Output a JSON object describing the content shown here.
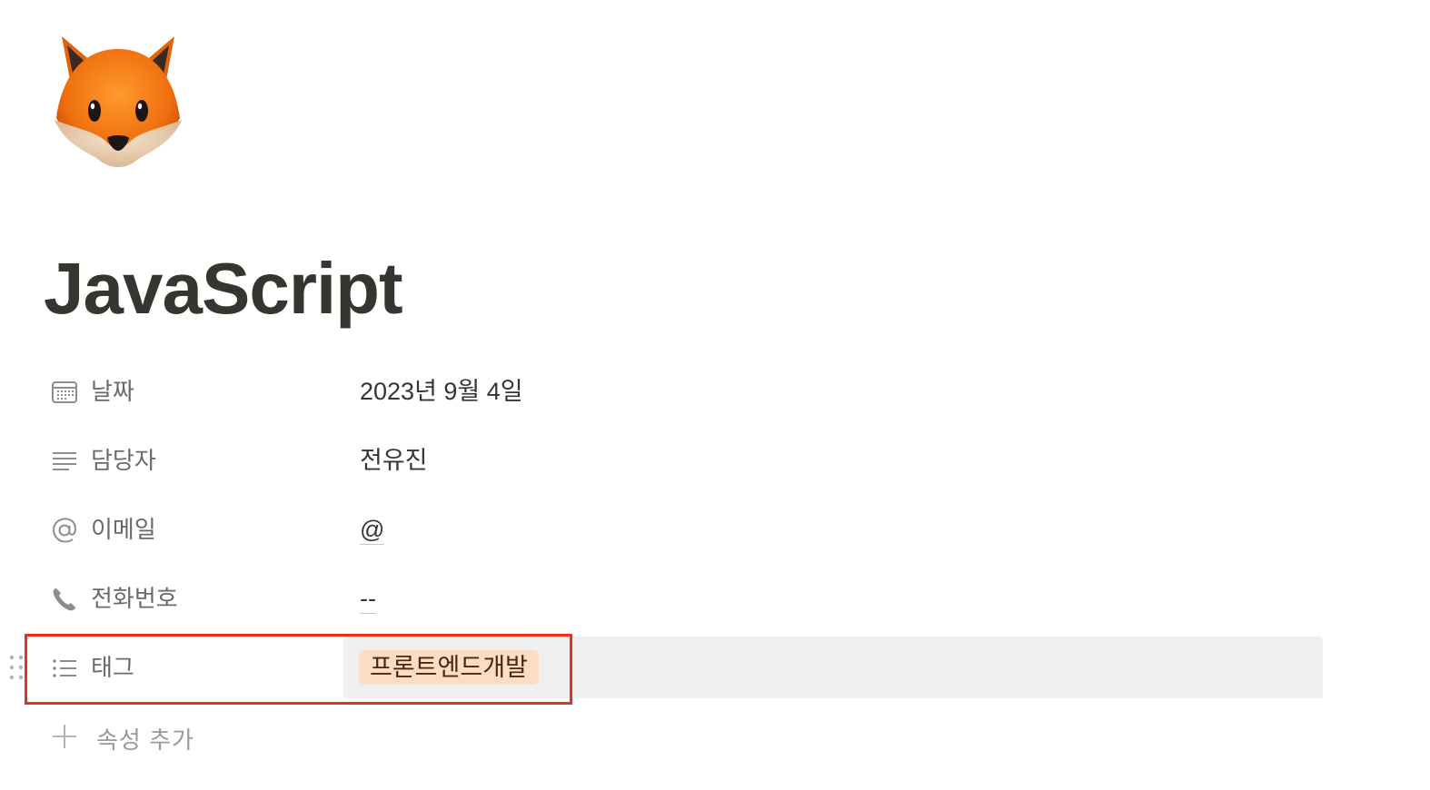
{
  "page": {
    "icon": "fox-face-icon",
    "title": "JavaScript"
  },
  "properties": [
    {
      "icon": "calendar-icon",
      "name": "날짜",
      "value": "2023년 9월 4일"
    },
    {
      "icon": "text-lines-icon",
      "name": "담당자",
      "value": "전유진"
    },
    {
      "icon": "at-sign-icon",
      "name": "이메일",
      "value": "@"
    },
    {
      "icon": "phone-icon",
      "name": "전화번호",
      "value": "--"
    },
    {
      "icon": "multi-select-list-icon",
      "name": "태그",
      "tag": "프론트엔드개발",
      "tag_color": "#fbdcc4"
    }
  ],
  "add_property": {
    "icon": "plus-icon",
    "label": "속성 추가"
  },
  "highlight": {
    "color": "#e8311c"
  }
}
